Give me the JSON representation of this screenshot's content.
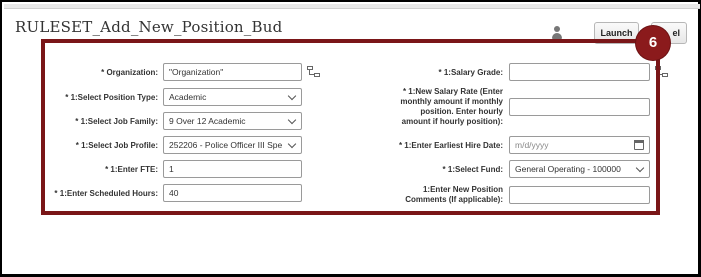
{
  "page": {
    "title": "RULESET_Add_New_Position_Bud"
  },
  "header": {
    "launch_label": "Launch",
    "cancel_label": "el"
  },
  "step_badge": {
    "number": "6"
  },
  "form": {
    "organization": {
      "label": "* Organization:",
      "value": "\"Organization\""
    },
    "position_type": {
      "label": "* 1:Select Position Type:",
      "value": "Academic"
    },
    "job_family": {
      "label": "* 1:Select Job Family:",
      "value": "9 Over 12  Academic"
    },
    "job_profile": {
      "label": "* 1:Select Job Profile:",
      "value": "252206 - Police Officer III Spe"
    },
    "fte": {
      "label": "* 1:Enter FTE:",
      "value": "1"
    },
    "scheduled_hours": {
      "label": "* 1:Enter Scheduled Hours:",
      "value": "40"
    },
    "salary_grade": {
      "label": "* 1:Salary Grade:",
      "value": ""
    },
    "new_salary_rate": {
      "label_lines": [
        "* 1:New Salary Rate (Enter",
        "monthly amount if monthly",
        "position. Enter hourly",
        "amount if hourly position):"
      ],
      "value": ""
    },
    "earliest_hire_date": {
      "label": "* 1:Enter Earliest Hire Date:",
      "placeholder": "m/d/yyyy"
    },
    "fund": {
      "label": "* 1:Select Fund:",
      "value": "General Operating - 100000"
    },
    "comments": {
      "label_lines": [
        "1:Enter New Position",
        "Comments (If applicable):"
      ],
      "value": ""
    }
  },
  "colors": {
    "highlight": "#7a1618",
    "badge": "#8b1a1c"
  }
}
